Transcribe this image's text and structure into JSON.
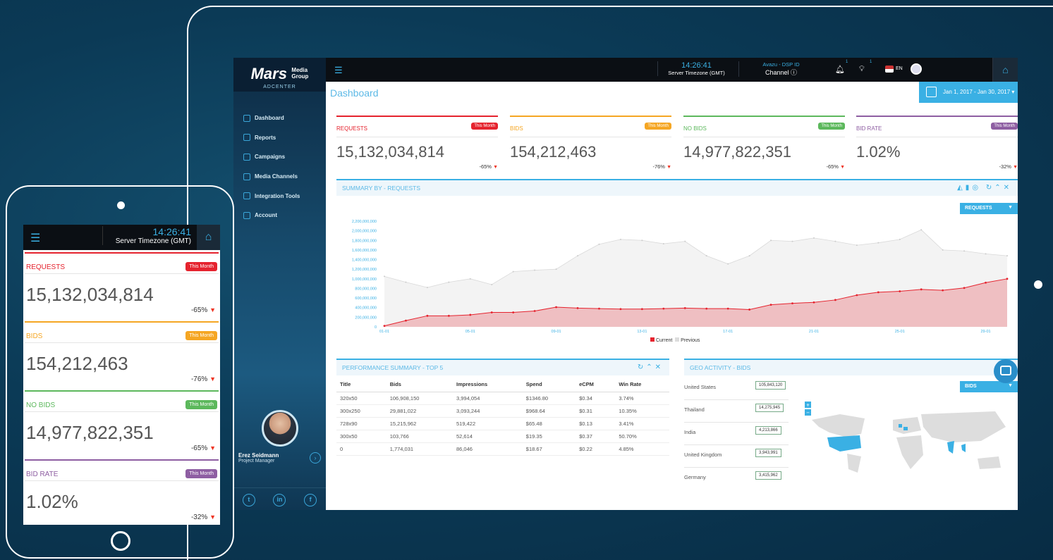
{
  "brand": {
    "logo_main": "Mars",
    "logo_sub1": "Media",
    "logo_sub2": "Group",
    "logo_center": "ADCENTER"
  },
  "sidebar": {
    "items": [
      {
        "label": "Dashboard"
      },
      {
        "label": "Reports"
      },
      {
        "label": "Campaigns"
      },
      {
        "label": "Media Channels"
      },
      {
        "label": "Integration Tools"
      },
      {
        "label": "Account"
      }
    ],
    "profile": {
      "name": "Erez Seidmann",
      "role": "Project Manager"
    },
    "social": [
      "t",
      "in",
      "f"
    ]
  },
  "topbar": {
    "time": "14:26:41",
    "timezone": "Server Timezone (GMT)",
    "channel_label": "Avazu - DSP ID",
    "channel_value": "Channel",
    "notif_badge": "1",
    "bulb_badge": "1",
    "lang": "EN"
  },
  "page": {
    "title": "Dashboard",
    "date_range": "Jan 1, 2017 - Jan 30, 2017"
  },
  "cards": [
    {
      "title": "REQUESTS",
      "badge": "This Month",
      "value": "15,132,034,814",
      "change": "-65%",
      "color": "#e5232e"
    },
    {
      "title": "BIDS",
      "badge": "This Month",
      "value": "154,212,463",
      "change": "-76%",
      "color": "#f5a623"
    },
    {
      "title": "NO BIDS",
      "badge": "This Month",
      "value": "14,977,822,351",
      "change": "-65%",
      "color": "#5cb85c"
    },
    {
      "title": "BID RATE",
      "badge": "This Month",
      "value": "1.02%",
      "change": "-32%",
      "color": "#8e5ea2"
    }
  ],
  "summary": {
    "title": "SUMMARY BY - REQUESTS",
    "dropdown": "REQUESTS",
    "legend_current": "Current",
    "legend_previous": "Previous"
  },
  "chart_data": {
    "type": "area",
    "x": [
      "01-01",
      "02-01",
      "03-01",
      "04-01",
      "05-01",
      "06-01",
      "07-01",
      "08-01",
      "09-01",
      "10-01",
      "11-01",
      "12-01",
      "13-01",
      "14-01",
      "15-01",
      "16-01",
      "17-01",
      "18-01",
      "19-01",
      "20-01",
      "21-01",
      "22-01",
      "23-01",
      "24-01",
      "25-01",
      "26-01",
      "27-01",
      "28-01",
      "29-01",
      "30-01"
    ],
    "x_tick_labels": [
      "01-01",
      "05-01",
      "09-01",
      "13-01",
      "17-01",
      "21-01",
      "25-01",
      "29-01"
    ],
    "y_tick_labels": [
      "0",
      "200,000,000",
      "400,000,000",
      "600,000,000",
      "800,000,000",
      "1,000,000,000",
      "1,200,000,000",
      "1,400,000,000",
      "1,600,000,000",
      "1,800,000,000",
      "2,000,000,000",
      "2,200,000,000"
    ],
    "ylim": [
      0,
      2200000000
    ],
    "series": [
      {
        "name": "Current",
        "color": "#e5232e",
        "values": [
          20000000,
          130000000,
          230000000,
          230000000,
          250000000,
          300000000,
          300000000,
          330000000,
          410000000,
          390000000,
          380000000,
          370000000,
          370000000,
          380000000,
          390000000,
          380000000,
          380000000,
          360000000,
          460000000,
          490000000,
          510000000,
          560000000,
          660000000,
          720000000,
          740000000,
          780000000,
          760000000,
          810000000,
          920000000,
          1000000000
        ]
      },
      {
        "name": "Previous",
        "color": "#d9d9d9",
        "values": [
          1050000000,
          930000000,
          820000000,
          930000000,
          1000000000,
          880000000,
          1150000000,
          1180000000,
          1200000000,
          1480000000,
          1720000000,
          1820000000,
          1800000000,
          1730000000,
          1780000000,
          1480000000,
          1310000000,
          1480000000,
          1800000000,
          1780000000,
          1850000000,
          1780000000,
          1700000000,
          1750000000,
          1820000000,
          2020000000,
          1600000000,
          1580000000,
          1520000000,
          1480000000
        ]
      }
    ]
  },
  "performance": {
    "title": "PERFORMANCE SUMMARY - TOP 5",
    "columns": [
      "Title",
      "Bids",
      "Impressions",
      "Spend",
      "eCPM",
      "Win Rate"
    ],
    "rows": [
      [
        "320x50",
        "106,908,150",
        "3,994,054",
        "$1346.80",
        "$0.34",
        "3.74%"
      ],
      [
        "300x250",
        "29,881,022",
        "3,093,244",
        "$968.64",
        "$0.31",
        "10.35%"
      ],
      [
        "728x90",
        "15,215,962",
        "519,422",
        "$65.48",
        "$0.13",
        "3.41%"
      ],
      [
        "300x50",
        "103,766",
        "52,614",
        "$19.35",
        "$0.37",
        "50.70%"
      ],
      [
        "0",
        "1,774,031",
        "86,046",
        "$18.67",
        "$0.22",
        "4.85%"
      ]
    ]
  },
  "geo": {
    "title": "GEO ACTIVITY - BIDS",
    "dropdown": "BIDS",
    "rows": [
      {
        "country": "United States",
        "value": "105,843,120"
      },
      {
        "country": "Thailand",
        "value": "14,275,945"
      },
      {
        "country": "India",
        "value": "4,213,866"
      },
      {
        "country": "United Kingdom",
        "value": "3,943,991"
      },
      {
        "country": "Germany",
        "value": "3,415,962"
      }
    ]
  }
}
